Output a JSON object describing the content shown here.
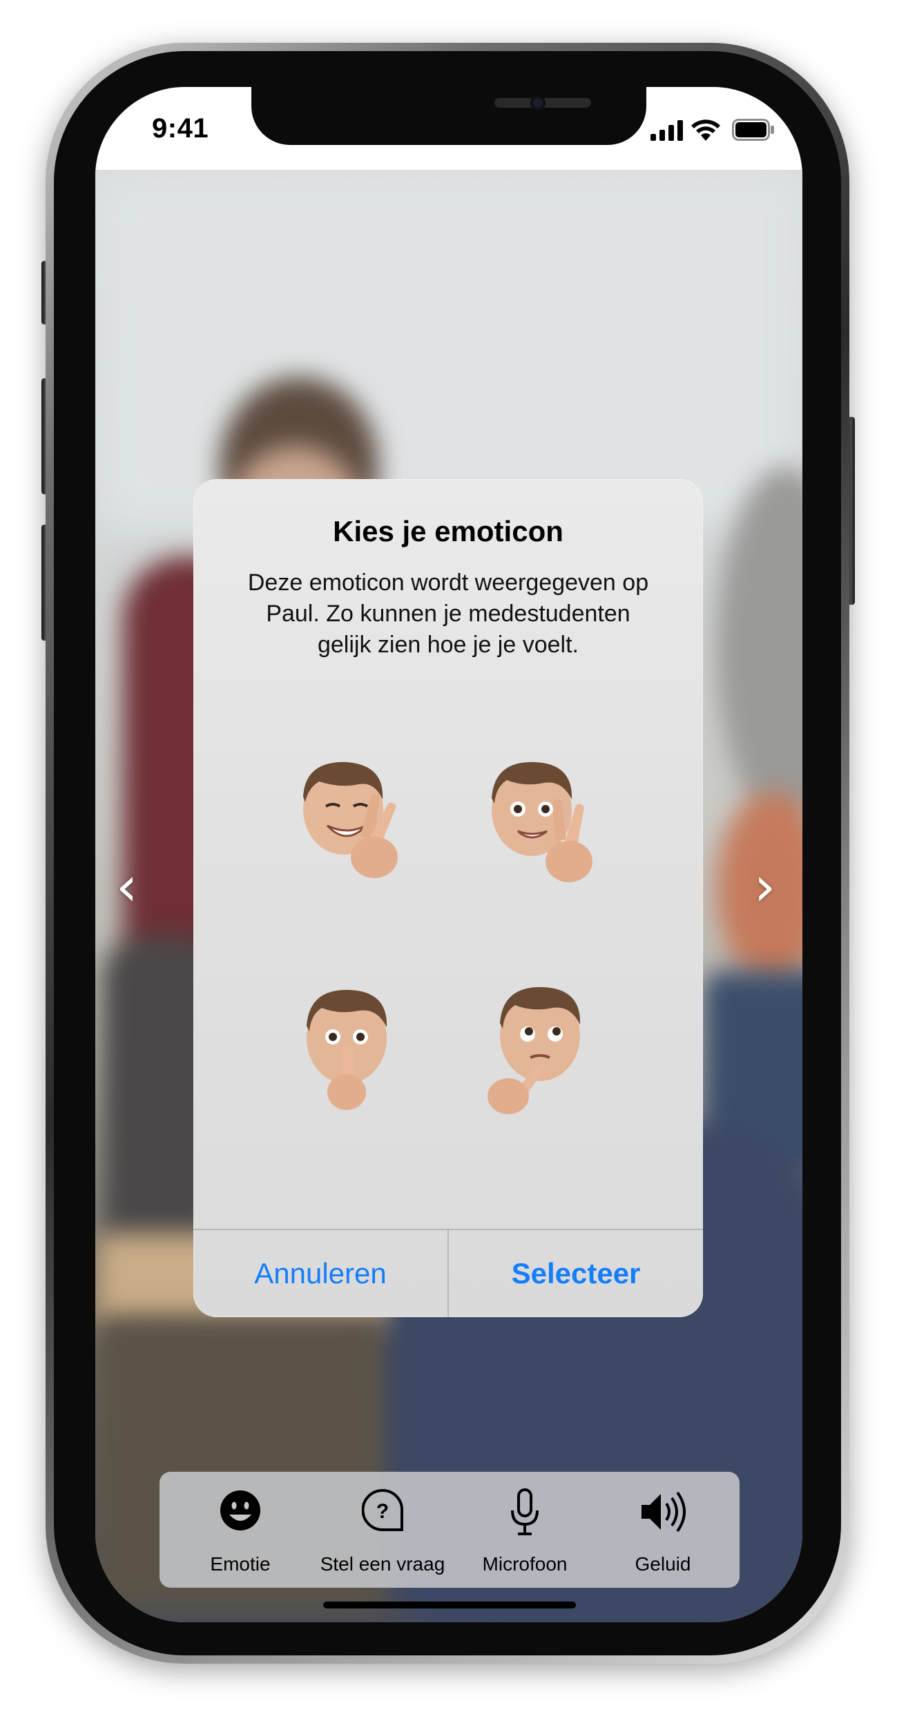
{
  "status_bar": {
    "time": "9:41"
  },
  "alert": {
    "title": "Kies je emoticon",
    "message_lines": [
      "Deze emoticon wordt weergegeven op",
      "Paul. Zo kunnen je medestudenten",
      "gelijk zien hoe je je voelt."
    ],
    "emoticons": [
      "fingers-crossed-memoji",
      "peace-sign-memoji",
      "shush-memoji",
      "thinking-memoji"
    ],
    "cancel_label": "Annuleren",
    "select_label": "Selecteer",
    "accent_color": "#157efb"
  },
  "navigation": {
    "previous_icon": "chevron-left-icon",
    "next_icon": "chevron-right-icon"
  },
  "toolbar": {
    "items": [
      {
        "label": "Emotie",
        "icon": "smiley-icon"
      },
      {
        "label": "Stel een vraag",
        "icon": "question-bubble-icon"
      },
      {
        "label": "Microfoon",
        "icon": "microphone-icon"
      },
      {
        "label": "Geluid",
        "icon": "speaker-icon"
      }
    ]
  }
}
